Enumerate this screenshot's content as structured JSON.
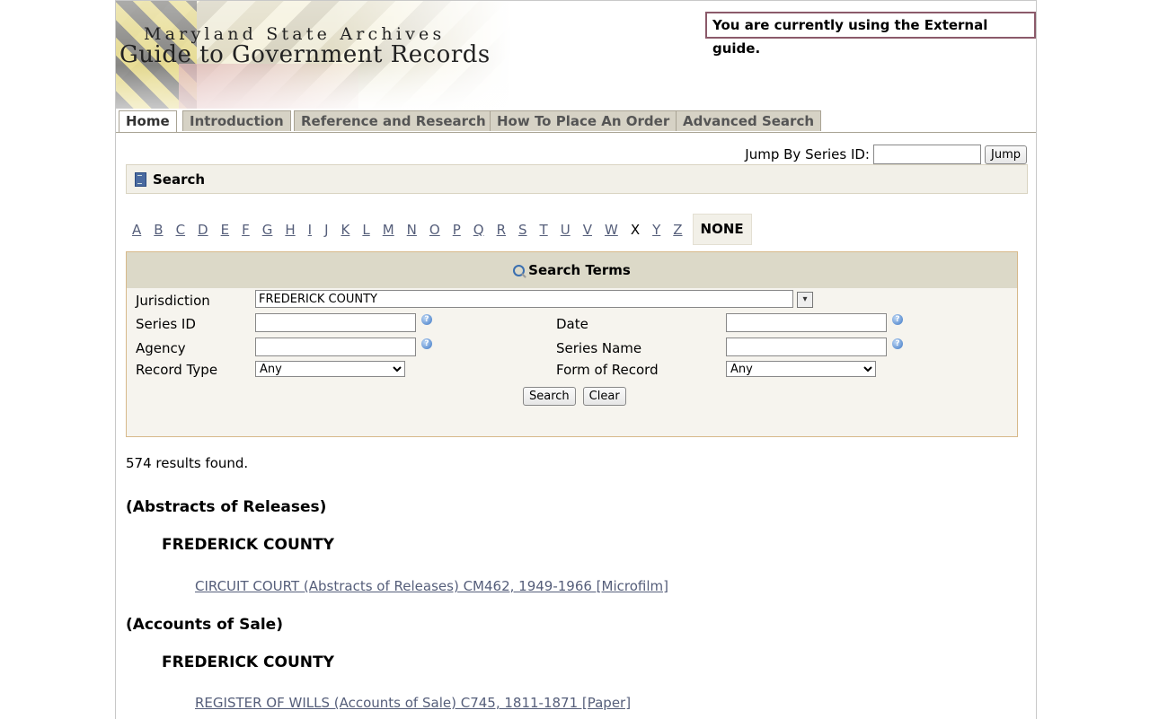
{
  "header": {
    "archive_name": "Maryland State Archives",
    "guide_title": "Guide to Government Records",
    "guide_notice": "You are currently using the External guide."
  },
  "tabs": [
    {
      "label": "Home",
      "active": true
    },
    {
      "label": "Introduction",
      "active": false
    },
    {
      "label": "Reference and Research",
      "active": false
    },
    {
      "label": "How To Place An Order",
      "active": false
    },
    {
      "label": "Advanced Search",
      "active": false
    }
  ],
  "jump": {
    "label": "Jump By Series ID:",
    "value": "",
    "button": "Jump"
  },
  "search_bar": {
    "label": "Search",
    "icon": "book-icon"
  },
  "letters": [
    "A",
    "B",
    "C",
    "D",
    "E",
    "F",
    "G",
    "H",
    "I",
    "J",
    "K",
    "L",
    "M",
    "N",
    "O",
    "P",
    "Q",
    "R",
    "S",
    "T",
    "U",
    "V",
    "W",
    "X",
    "Y",
    "Z"
  ],
  "current_letter": "X",
  "none_label": "NONE",
  "search_terms": {
    "title": "Search Terms",
    "jurisdiction_label": "Jurisdiction",
    "jurisdiction_value": "FREDERICK COUNTY",
    "series_id_label": "Series ID",
    "series_id_value": "",
    "date_label": "Date",
    "date_value": "",
    "agency_label": "Agency",
    "agency_value": "",
    "series_name_label": "Series Name",
    "series_name_value": "",
    "record_type_label": "Record Type",
    "record_type_value": "Any",
    "form_label": "Form of Record",
    "form_value": "Any",
    "search_button": "Search",
    "clear_button": "Clear"
  },
  "results": {
    "count_text": "574 results found.",
    "groups": [
      {
        "category": "(Abstracts of Releases)",
        "county": "FREDERICK COUNTY",
        "link": "CIRCUIT COURT (Abstracts of Releases) CM462, 1949-1966 [Microfilm]"
      },
      {
        "category": "(Accounts of Sale)",
        "county": "FREDERICK COUNTY",
        "link": "REGISTER OF WILLS (Accounts of Sale) C745, 1811-1871 [Paper]"
      }
    ]
  }
}
